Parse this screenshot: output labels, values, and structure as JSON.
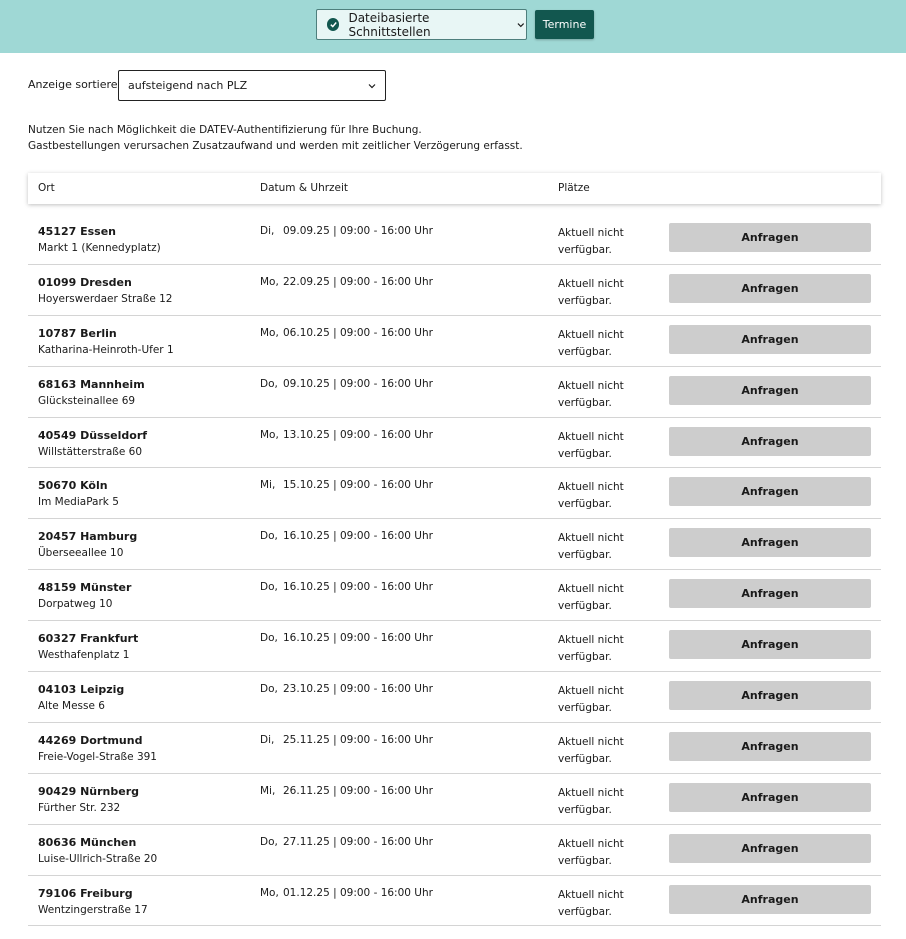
{
  "header": {
    "dropdown_label": "Dateibasierte Schnittstellen",
    "termine_label": "Termine",
    "accent": "#12574f",
    "background": "#9fd8d5"
  },
  "sort": {
    "label": "Anzeige sortieren:",
    "value": "aufsteigend nach PLZ"
  },
  "notice": {
    "line1": "Nutzen Sie nach Möglichkeit die DATEV-Authentifizierung für Ihre Buchung.",
    "line2": "Gastbestellungen verursachen Zusatzaufwand und werden mit zeitlicher Verzögerung erfasst."
  },
  "table": {
    "col_location": "Ort",
    "col_datetime": "Datum & Uhrzeit",
    "col_seats": "Plätze",
    "rows": [
      {
        "city": "45127 Essen",
        "street": "Markt 1 (Kennedyplatz)",
        "day": "Di,",
        "date": "09.09.25  | 09:00 - 16:00 Uhr",
        "status": "Aktuell nicht verfügbar.",
        "action": "Anfragen"
      },
      {
        "city": "01099 Dresden",
        "street": "Hoyerswerdaer Straße 12",
        "day": "Mo,",
        "date": "22.09.25  | 09:00 - 16:00 Uhr",
        "status": "Aktuell nicht verfügbar.",
        "action": "Anfragen"
      },
      {
        "city": "10787 Berlin",
        "street": "Katharina-Heinroth-Ufer 1",
        "day": "Mo,",
        "date": "06.10.25  | 09:00 - 16:00 Uhr",
        "status": "Aktuell nicht verfügbar.",
        "action": "Anfragen"
      },
      {
        "city": "68163 Mannheim",
        "street": "Glücksteinallee 69",
        "day": "Do,",
        "date": "09.10.25  | 09:00 - 16:00 Uhr",
        "status": "Aktuell nicht verfügbar.",
        "action": "Anfragen"
      },
      {
        "city": "40549 Düsseldorf",
        "street": "Willstätterstraße 60",
        "day": "Mo,",
        "date": "13.10.25  | 09:00 - 16:00 Uhr",
        "status": "Aktuell nicht verfügbar.",
        "action": "Anfragen"
      },
      {
        "city": "50670 Köln",
        "street": "Im MediaPark 5",
        "day": "Mi,",
        "date": "15.10.25  | 09:00 - 16:00 Uhr",
        "status": "Aktuell nicht verfügbar.",
        "action": "Anfragen"
      },
      {
        "city": "20457 Hamburg",
        "street": "Überseeallee 10",
        "day": "Do,",
        "date": "16.10.25  | 09:00 - 16:00 Uhr",
        "status": "Aktuell nicht verfügbar.",
        "action": "Anfragen"
      },
      {
        "city": "48159 Münster",
        "street": "Dorpatweg 10",
        "day": "Do,",
        "date": "16.10.25  | 09:00 - 16:00 Uhr",
        "status": "Aktuell nicht verfügbar.",
        "action": "Anfragen"
      },
      {
        "city": "60327 Frankfurt",
        "street": "Westhafenplatz 1",
        "day": "Do,",
        "date": "16.10.25  | 09:00 - 16:00 Uhr",
        "status": "Aktuell nicht verfügbar.",
        "action": "Anfragen"
      },
      {
        "city": "04103 Leipzig",
        "street": "Alte Messe 6",
        "day": "Do,",
        "date": "23.10.25  | 09:00 - 16:00 Uhr",
        "status": "Aktuell nicht verfügbar.",
        "action": "Anfragen"
      },
      {
        "city": "44269 Dortmund",
        "street": "Freie-Vogel-Straße 391",
        "day": "Di,",
        "date": "25.11.25  | 09:00 - 16:00 Uhr",
        "status": "Aktuell nicht verfügbar.",
        "action": "Anfragen"
      },
      {
        "city": "90429 Nürnberg",
        "street": "Fürther Str. 232",
        "day": "Mi,",
        "date": "26.11.25  | 09:00 - 16:00 Uhr",
        "status": "Aktuell nicht verfügbar.",
        "action": "Anfragen"
      },
      {
        "city": "80636 München",
        "street": "Luise-Ullrich-Straße 20",
        "day": "Do,",
        "date": "27.11.25  | 09:00 - 16:00 Uhr",
        "status": "Aktuell nicht verfügbar.",
        "action": "Anfragen"
      },
      {
        "city": "79106 Freiburg",
        "street": "Wentzingerstraße 17",
        "day": "Mo,",
        "date": "01.12.25  | 09:00 - 16:00 Uhr",
        "status": "Aktuell nicht verfügbar.",
        "action": "Anfragen"
      }
    ]
  }
}
